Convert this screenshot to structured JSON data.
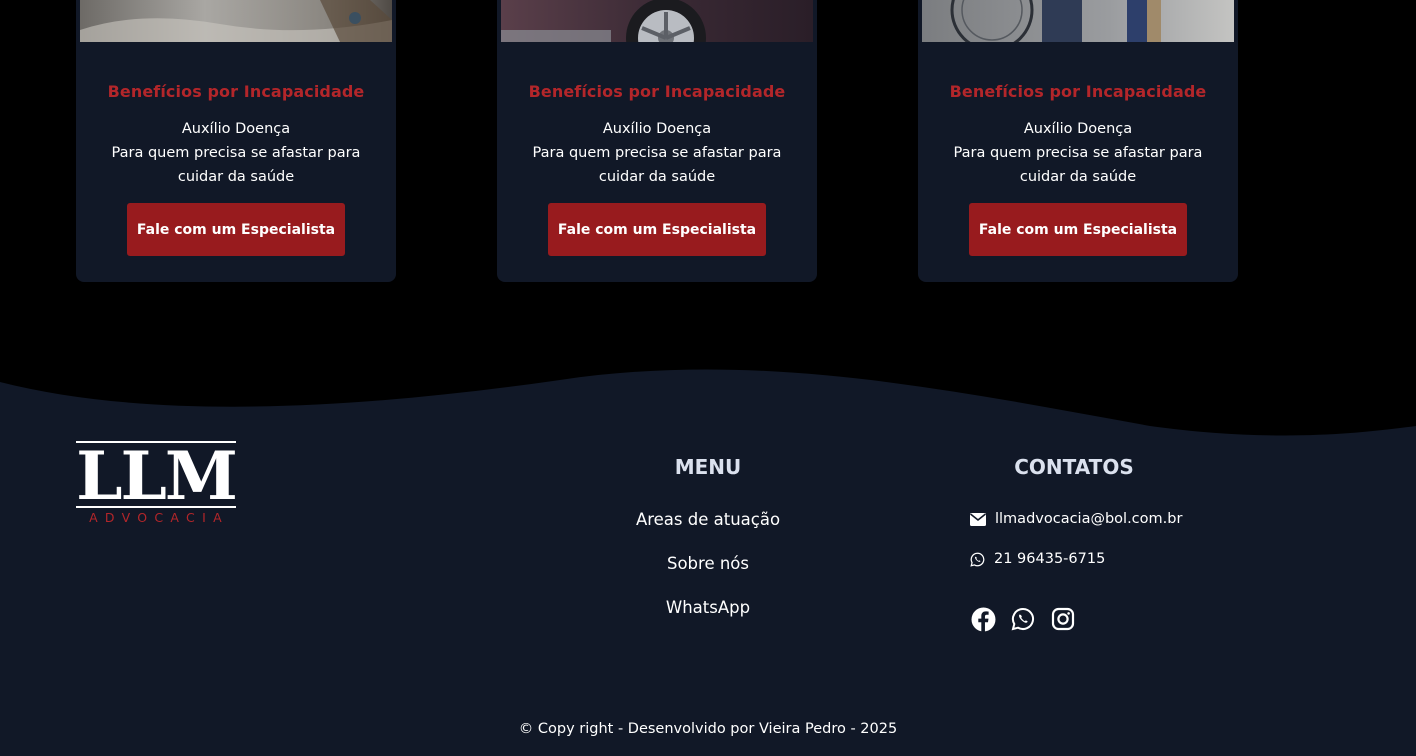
{
  "cards": [
    {
      "title": "Benefícios por Incapacidade",
      "subtitle": "Auxílio Doença",
      "description": "Para quem precisa se afastar para cuidar da saúde",
      "button_label": "Fale com um Especialista"
    },
    {
      "title": "Benefícios por Incapacidade",
      "subtitle": "Auxílio Doença",
      "description": "Para quem precisa se afastar para cuidar da saúde",
      "button_label": "Fale com um Especialista"
    },
    {
      "title": "Benefícios por Incapacidade",
      "subtitle": "Auxílio Doença",
      "description": "Para quem precisa se afastar para cuidar da saúde",
      "button_label": "Fale com um Especialista"
    }
  ],
  "footer": {
    "logo": {
      "letters": "LLM",
      "tagline": "ADVOCACIA"
    },
    "menu": {
      "title": "MENU",
      "items": [
        "Areas de atuação",
        "Sobre nós",
        "WhatsApp"
      ]
    },
    "contacts": {
      "title": "CONTATOS",
      "email": "llmadvocacia@bol.com.br",
      "phone": "21 96435-6715",
      "email_icon": "envelope-icon",
      "phone_icon": "whatsapp-icon",
      "social": [
        "facebook-icon",
        "whatsapp-icon",
        "instagram-icon"
      ]
    },
    "copyright": "© Copy right - Desenvolvido por Vieira Pedro - 2025"
  },
  "colors": {
    "page_bg": "#000000",
    "card_bg": "#111827",
    "accent_red": "#981b1e",
    "title_red": "#b3262a",
    "footer_bg": "#111827"
  }
}
